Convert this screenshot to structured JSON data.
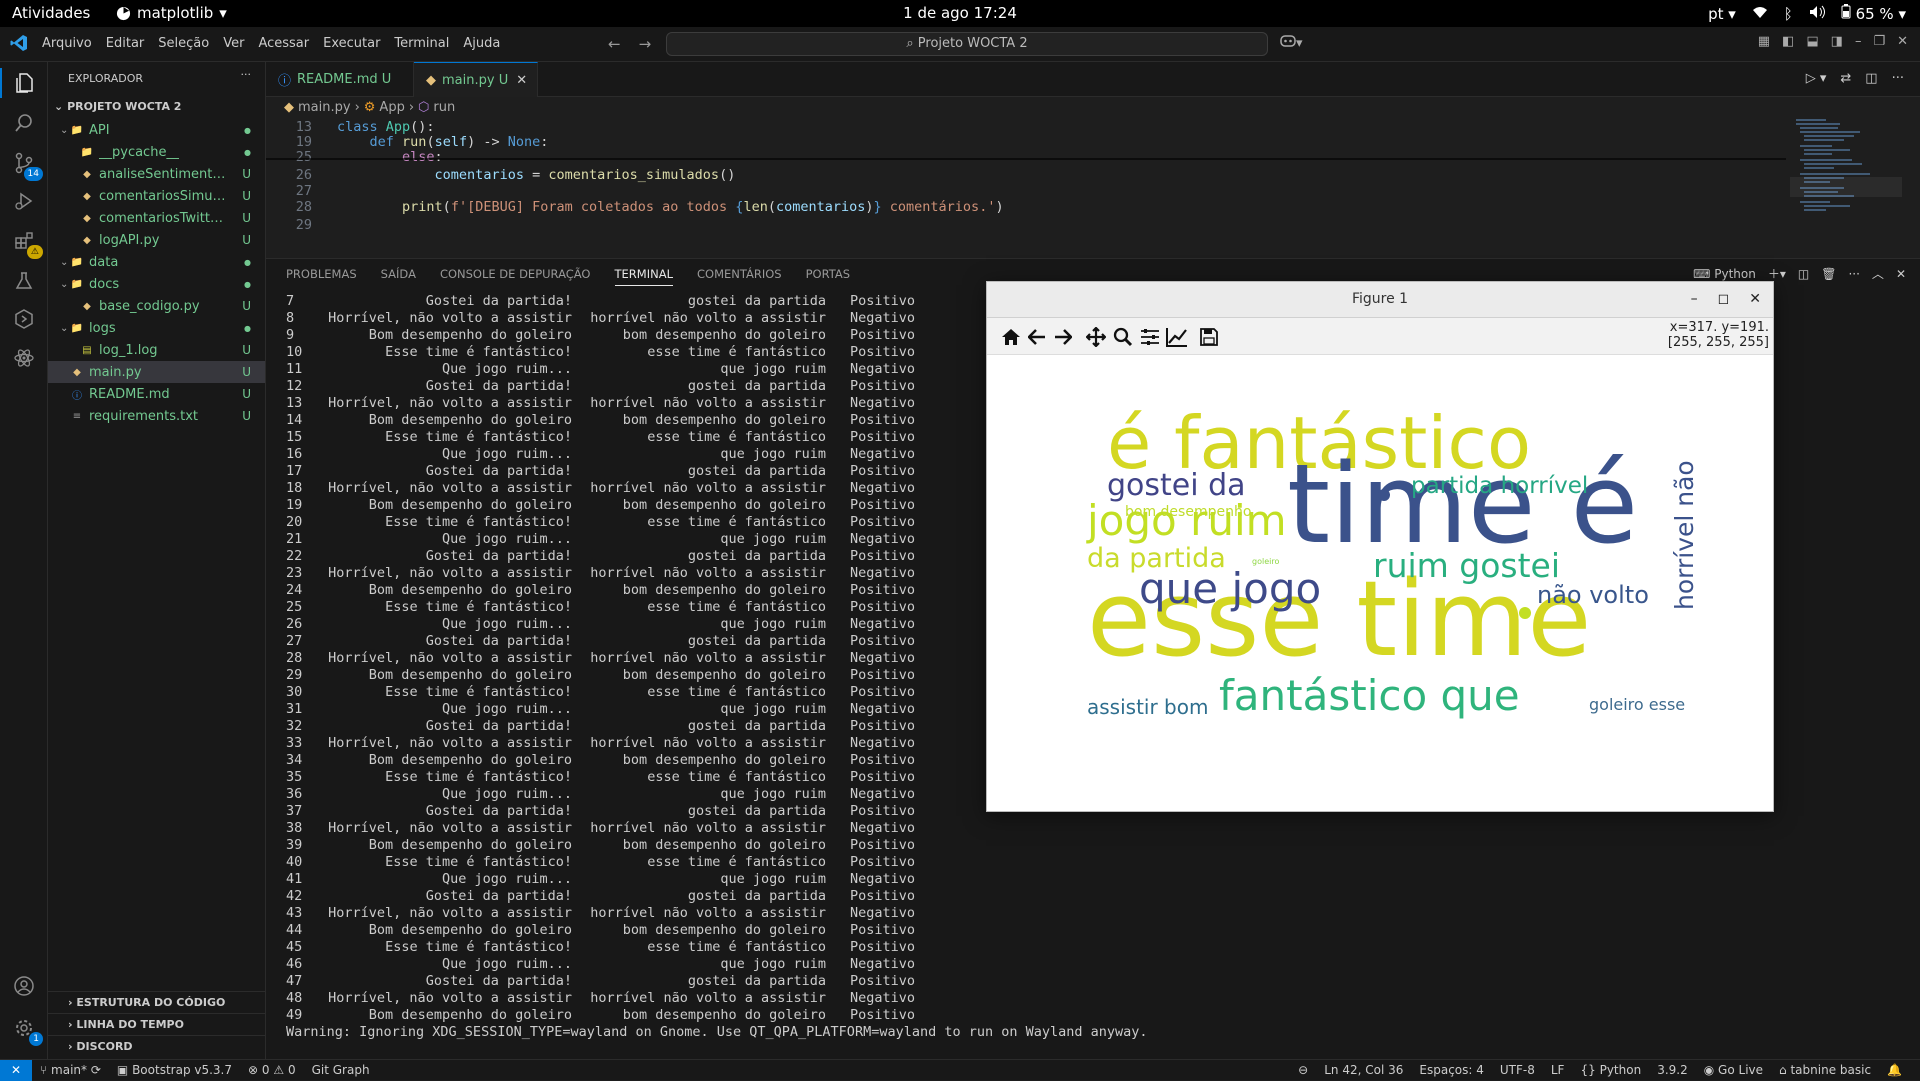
{
  "gnome": {
    "activities": "Atividades",
    "app": "matplotlib",
    "clock": "1 de ago  17:24",
    "lang": "pt",
    "battery": "65 %"
  },
  "titlebar": {
    "menu": [
      "Arquivo",
      "Editar",
      "Seleção",
      "Ver",
      "Acessar",
      "Executar",
      "Terminal",
      "Ajuda"
    ],
    "search": "Projeto WOCTA 2"
  },
  "sidebar": {
    "title": "EXPLORADOR",
    "project": "PROJETO WOCTA 2",
    "items": [
      {
        "label": "API",
        "depth": 0,
        "type": "folder",
        "status": "●"
      },
      {
        "label": "__pycache__",
        "depth": 1,
        "type": "folder",
        "status": "●"
      },
      {
        "label": "analiseSentimentos.py",
        "depth": 1,
        "type": "py",
        "status": "U"
      },
      {
        "label": "comentariosSimulados....",
        "depth": 1,
        "type": "py",
        "status": "U"
      },
      {
        "label": "comentariosTwitter.py",
        "depth": 1,
        "type": "py",
        "status": "U"
      },
      {
        "label": "logAPI.py",
        "depth": 1,
        "type": "py",
        "status": "U"
      },
      {
        "label": "data",
        "depth": 0,
        "type": "folder",
        "status": "●"
      },
      {
        "label": "docs",
        "depth": 0,
        "type": "folder",
        "status": "●"
      },
      {
        "label": "base_codigo.py",
        "depth": 1,
        "type": "py",
        "status": "U"
      },
      {
        "label": "logs",
        "depth": 0,
        "type": "folder",
        "status": "●"
      },
      {
        "label": "log_1.log",
        "depth": 1,
        "type": "log",
        "status": "U"
      },
      {
        "label": "main.py",
        "depth": 0,
        "type": "py",
        "status": "U"
      },
      {
        "label": "README.md",
        "depth": 0,
        "type": "md",
        "status": "U"
      },
      {
        "label": "requirements.txt",
        "depth": 0,
        "type": "txt",
        "status": "U"
      }
    ],
    "sections": [
      "ESTRUTURA DO CÓDIGO",
      "LINHA DO TEMPO",
      "DISCORD"
    ]
  },
  "activity": {
    "scm_badge": "14",
    "settings_badge": "1"
  },
  "tabs": [
    {
      "label": "README.md",
      "status": "U"
    },
    {
      "label": "main.py",
      "status": "U"
    }
  ],
  "breadcrumb": [
    "main.py",
    "App",
    "run"
  ],
  "code": [
    {
      "n": "13",
      "html": "<span class='kw'>class</span> <span class='cls'>App</span><span class='pn'>():</span>"
    },
    {
      "n": "19",
      "html": "    <span class='kw'>def</span> <span class='fn'>run</span><span class='pn'>(</span><span class='var'>self</span><span class='pn'>) -&gt; </span><span class='kw'>None</span><span class='pn'>:</span>"
    },
    {
      "n": "25",
      "html": "        <span class='kw2'>else</span><span class='pn'>:</span>"
    },
    {
      "n": "26",
      "html": "            <span class='var'>comentarios</span> <span class='pn'>=</span> <span class='fn'>comentarios_simulados</span><span class='pn'>()</span>"
    },
    {
      "n": "27",
      "html": ""
    },
    {
      "n": "28",
      "html": "        <span class='fn'>print</span><span class='pn'>(</span><span class='str'>f'[DEBUG] Foram coletados ao todos </span><span class='kw'>{</span><span class='fn'>len</span><span class='pn'>(</span><span class='var'>comentarios</span><span class='pn'>)</span><span class='kw'>}</span><span class='str'> comentários.'</span><span class='pn'>)</span>"
    },
    {
      "n": "29",
      "html": ""
    }
  ],
  "panel": {
    "tabs": [
      "PROBLEMAS",
      "SAÍDA",
      "CONSOLE DE DEPURAÇÃO",
      "TERMINAL",
      "COMENTÁRIOS",
      "PORTAS"
    ],
    "active": "TERMINAL",
    "shell": "Python"
  },
  "terminal_rows": [
    [
      "7",
      "Gostei da partida!",
      "gostei da partida",
      "Positivo"
    ],
    [
      "8",
      "Horrível, não volto a assistir",
      "horrível não volto a assistir",
      "Negativo"
    ],
    [
      "9",
      "Bom desempenho do goleiro",
      "bom desempenho do goleiro",
      "Positivo"
    ],
    [
      "10",
      "Esse time é fantástico!",
      "esse time é fantástico",
      "Positivo"
    ],
    [
      "11",
      "Que jogo ruim...",
      "que jogo ruim",
      "Negativo"
    ],
    [
      "12",
      "Gostei da partida!",
      "gostei da partida",
      "Positivo"
    ],
    [
      "13",
      "Horrível, não volto a assistir",
      "horrível não volto a assistir",
      "Negativo"
    ],
    [
      "14",
      "Bom desempenho do goleiro",
      "bom desempenho do goleiro",
      "Positivo"
    ],
    [
      "15",
      "Esse time é fantástico!",
      "esse time é fantástico",
      "Positivo"
    ],
    [
      "16",
      "Que jogo ruim...",
      "que jogo ruim",
      "Negativo"
    ],
    [
      "17",
      "Gostei da partida!",
      "gostei da partida",
      "Positivo"
    ],
    [
      "18",
      "Horrível, não volto a assistir",
      "horrível não volto a assistir",
      "Negativo"
    ],
    [
      "19",
      "Bom desempenho do goleiro",
      "bom desempenho do goleiro",
      "Positivo"
    ],
    [
      "20",
      "Esse time é fantástico!",
      "esse time é fantástico",
      "Positivo"
    ],
    [
      "21",
      "Que jogo ruim...",
      "que jogo ruim",
      "Negativo"
    ],
    [
      "22",
      "Gostei da partida!",
      "gostei da partida",
      "Positivo"
    ],
    [
      "23",
      "Horrível, não volto a assistir",
      "horrível não volto a assistir",
      "Negativo"
    ],
    [
      "24",
      "Bom desempenho do goleiro",
      "bom desempenho do goleiro",
      "Positivo"
    ],
    [
      "25",
      "Esse time é fantástico!",
      "esse time é fantástico",
      "Positivo"
    ],
    [
      "26",
      "Que jogo ruim...",
      "que jogo ruim",
      "Negativo"
    ],
    [
      "27",
      "Gostei da partida!",
      "gostei da partida",
      "Positivo"
    ],
    [
      "28",
      "Horrível, não volto a assistir",
      "horrível não volto a assistir",
      "Negativo"
    ],
    [
      "29",
      "Bom desempenho do goleiro",
      "bom desempenho do goleiro",
      "Positivo"
    ],
    [
      "30",
      "Esse time é fantástico!",
      "esse time é fantástico",
      "Positivo"
    ],
    [
      "31",
      "Que jogo ruim...",
      "que jogo ruim",
      "Negativo"
    ],
    [
      "32",
      "Gostei da partida!",
      "gostei da partida",
      "Positivo"
    ],
    [
      "33",
      "Horrível, não volto a assistir",
      "horrível não volto a assistir",
      "Negativo"
    ],
    [
      "34",
      "Bom desempenho do goleiro",
      "bom desempenho do goleiro",
      "Positivo"
    ],
    [
      "35",
      "Esse time é fantástico!",
      "esse time é fantástico",
      "Positivo"
    ],
    [
      "36",
      "Que jogo ruim...",
      "que jogo ruim",
      "Negativo"
    ],
    [
      "37",
      "Gostei da partida!",
      "gostei da partida",
      "Positivo"
    ],
    [
      "38",
      "Horrível, não volto a assistir",
      "horrível não volto a assistir",
      "Negativo"
    ],
    [
      "39",
      "Bom desempenho do goleiro",
      "bom desempenho do goleiro",
      "Positivo"
    ],
    [
      "40",
      "Esse time é fantástico!",
      "esse time é fantástico",
      "Positivo"
    ],
    [
      "41",
      "Que jogo ruim...",
      "que jogo ruim",
      "Negativo"
    ],
    [
      "42",
      "Gostei da partida!",
      "gostei da partida",
      "Positivo"
    ],
    [
      "43",
      "Horrível, não volto a assistir",
      "horrível não volto a assistir",
      "Negativo"
    ],
    [
      "44",
      "Bom desempenho do goleiro",
      "bom desempenho do goleiro",
      "Positivo"
    ],
    [
      "45",
      "Esse time é fantástico!",
      "esse time é fantástico",
      "Positivo"
    ],
    [
      "46",
      "Que jogo ruim...",
      "que jogo ruim",
      "Negativo"
    ],
    [
      "47",
      "Gostei da partida!",
      "gostei da partida",
      "Positivo"
    ],
    [
      "48",
      "Horrível, não volto a assistir",
      "horrível não volto a assistir",
      "Negativo"
    ],
    [
      "49",
      "Bom desempenho do goleiro",
      "bom desempenho do goleiro",
      "Positivo"
    ]
  ],
  "terminal_warning": "Warning: Ignoring XDG_SESSION_TYPE=wayland on Gnome. Use QT_QPA_PLATFORM=wayland to run on Wayland anyway.",
  "figure": {
    "title": "Figure 1",
    "coords": "x=317. y=191.",
    "pixel": "[255, 255, 255]",
    "words": [
      {
        "text": "é fantástico",
        "color": "#d4d722"
      },
      {
        "text": "time é",
        "color": "#3b528b"
      },
      {
        "text": "esse time",
        "color": "#d4d722"
      },
      {
        "text": "gostei da",
        "color": "#414487"
      },
      {
        "text": "jogo ruim",
        "color": "#c2df23"
      },
      {
        "text": "partida horrível",
        "color": "#25a784"
      },
      {
        "text": "bom desempenho",
        "color": "#bfdc2a"
      },
      {
        "text": "da partida",
        "color": "#c9db2c"
      },
      {
        "text": "goleiro",
        "color": "#8fd744"
      },
      {
        "text": "que jogo",
        "color": "#3e4a89"
      },
      {
        "text": "ruim gostei",
        "color": "#29af7f"
      },
      {
        "text": "não volto",
        "color": "#39568c"
      },
      {
        "text": "horrível não",
        "color": "#3b528b"
      },
      {
        "text": "fantástico que",
        "color": "#2fb47c"
      },
      {
        "text": "assistir bom",
        "color": "#2e6e8e"
      },
      {
        "text": "goleiro esse",
        "color": "#3e6b8e"
      }
    ]
  },
  "statusbar": {
    "branch": "main*",
    "bootstrap": "Bootstrap v5.3.7",
    "problems": "0",
    "warnings": "0",
    "gitgraph": "Git Graph",
    "position": "Ln 42, Col 36",
    "spaces": "Espaços: 4",
    "encoding": "UTF-8",
    "eol": "LF",
    "lang": "Python",
    "version": "3.9.2",
    "golive": "Go Live",
    "tabnine": "tabnine basic"
  }
}
